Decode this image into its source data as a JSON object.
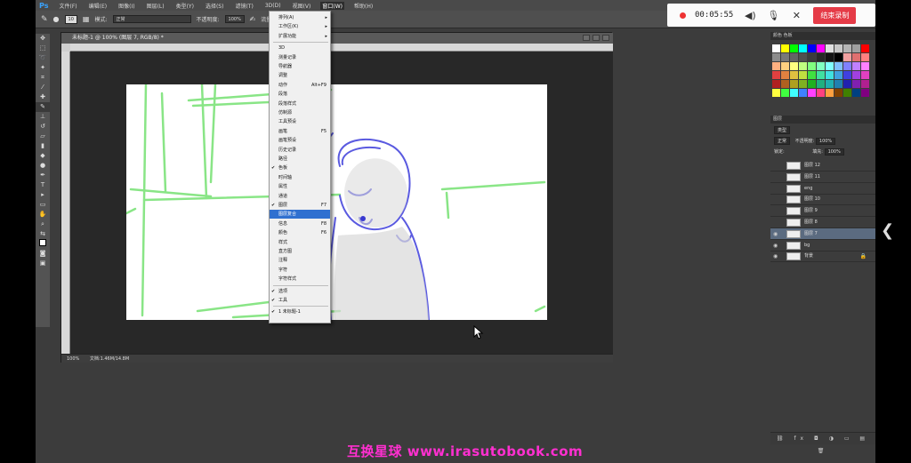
{
  "menubar": {
    "logo": "Ps",
    "items": [
      "文件(F)",
      "编辑(E)",
      "图像(I)",
      "图层(L)",
      "类型(Y)",
      "选择(S)",
      "滤镜(T)",
      "3D(D)",
      "视图(V)",
      "窗口(W)",
      "帮助(H)"
    ],
    "active_index": 9
  },
  "options": {
    "mode_label": "模式:",
    "mode_value": "正常",
    "opacity_label": "不透明度:",
    "opacity_value": "100%",
    "flow_label": "流量:"
  },
  "document": {
    "tab_title": "未标题-1 @ 100% (图层 7, RGB/8) *",
    "zoom": "100%",
    "doc_info": "文档:1.46M/14.8M"
  },
  "window_menu": {
    "items": [
      {
        "label": "排列(A)",
        "submenu": true
      },
      {
        "label": "工作区(K)",
        "submenu": true
      },
      {
        "label": "扩展功能",
        "submenu": true
      },
      {
        "label": "3D"
      },
      {
        "label": "测量记录"
      },
      {
        "label": "导航器"
      },
      {
        "label": "调整"
      },
      {
        "label": "动作",
        "shortcut": "Alt+F9"
      },
      {
        "label": "段落"
      },
      {
        "label": "段落样式"
      },
      {
        "label": "仿制源"
      },
      {
        "label": "工具预设"
      },
      {
        "label": "画笔",
        "shortcut": "F5"
      },
      {
        "label": "画笔预设"
      },
      {
        "label": "历史记录"
      },
      {
        "label": "路径"
      },
      {
        "label": "色板",
        "checked": true
      },
      {
        "label": "时间轴"
      },
      {
        "label": "属性"
      },
      {
        "label": "通道"
      },
      {
        "label": "图层",
        "shortcut": "F7",
        "checked": true
      },
      {
        "label": "图层复合",
        "selected": true
      },
      {
        "label": "信息",
        "shortcut": "F8"
      },
      {
        "label": "颜色",
        "shortcut": "F6"
      },
      {
        "label": "样式"
      },
      {
        "label": "直方图"
      },
      {
        "label": "注释"
      },
      {
        "label": "字符"
      },
      {
        "label": "字符样式"
      },
      {
        "label": "选项",
        "checked": true
      },
      {
        "label": "工具",
        "checked": true
      },
      {
        "label": "1 未标题-1",
        "checked": true
      }
    ]
  },
  "recorder": {
    "time": "00:05:55",
    "end_label": "结束录制"
  },
  "swatches": {
    "tabs": "颜色  色板",
    "colors": [
      "#ffffff",
      "#ffff00",
      "#00ff00",
      "#00ffff",
      "#0000ff",
      "#ff00ff",
      "#e0e0e0",
      "#c8c8c8",
      "#b4b4b4",
      "#a0a0a0",
      "#ff0000",
      "#8c8c8c",
      "#787878",
      "#646464",
      "#505050",
      "#3c3c3c",
      "#282828",
      "#141414",
      "#000000",
      "#f0a0a0",
      "#e07070",
      "#ff8080",
      "#ffb080",
      "#ffd080",
      "#ffff80",
      "#c0ff80",
      "#80ff80",
      "#80ffc0",
      "#80ffff",
      "#80c0ff",
      "#8080ff",
      "#c080ff",
      "#ff80ff",
      "#e04040",
      "#e08040",
      "#e0c040",
      "#c0e040",
      "#40e040",
      "#40e0a0",
      "#40e0e0",
      "#40a0e0",
      "#4040e0",
      "#a040e0",
      "#e040c0",
      "#b02020",
      "#b06020",
      "#b0a020",
      "#80b020",
      "#20b020",
      "#20b080",
      "#20b0b0",
      "#2080b0",
      "#2020b0",
      "#8020b0",
      "#b02090",
      "#ffff40",
      "#40ff40",
      "#40ffff",
      "#4080ff",
      "#ff40ff",
      "#ff4080",
      "#ffa040",
      "#804000",
      "#408000",
      "#004080",
      "#800080"
    ]
  },
  "layers": {
    "tab": "图层",
    "kind": "类型",
    "blend": "正常",
    "opacity_label": "不透明度:",
    "opacity_value": "100%",
    "lock_label": "锁定:",
    "fill_label": "填充:",
    "fill_value": "100%",
    "items": [
      {
        "name": "图层 12",
        "visible": false
      },
      {
        "name": "图层 11",
        "visible": false
      },
      {
        "name": "eng",
        "visible": false
      },
      {
        "name": "图层 10",
        "visible": false
      },
      {
        "name": "图层 9",
        "visible": false
      },
      {
        "name": "图层 8",
        "visible": false
      },
      {
        "name": "图层 7",
        "visible": true,
        "selected": true
      },
      {
        "name": "bg",
        "visible": true
      },
      {
        "name": "背景",
        "visible": true,
        "locked": true
      }
    ],
    "footer": "⛓ fx ◘ ◑ ▭ ▤ 🗑"
  },
  "watermark": "互换星球 www.irasutobook.com",
  "colors": {
    "accent": "#3070d0",
    "record_red": "#e53b47",
    "stroke_blue": "#5a5ae0",
    "stroke_green": "#7de37a"
  }
}
